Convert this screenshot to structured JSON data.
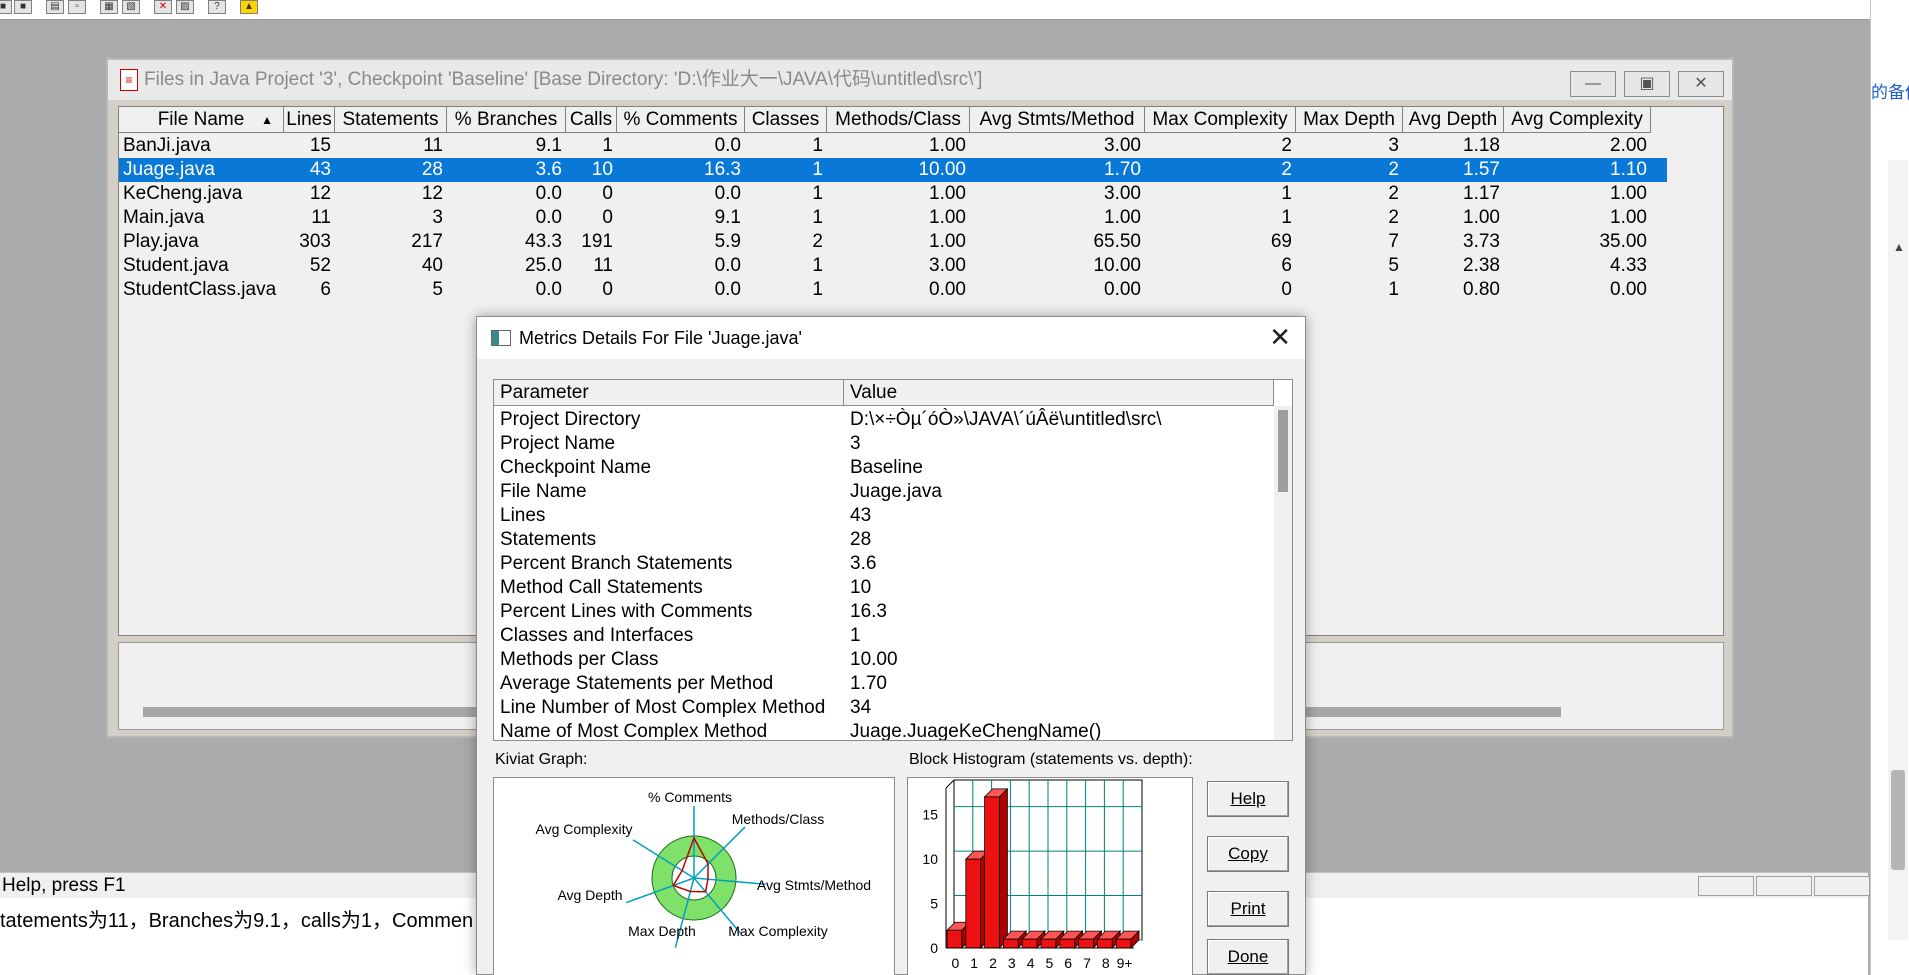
{
  "status_bar": {
    "text": "Help, press F1"
  },
  "below_text": "tatements为11，Branches为9.1，calls为1，Commen",
  "right_partial_text": "的备份",
  "files_window": {
    "title": "Files in Java Project '3', Checkpoint 'Baseline'  [Base Directory: 'D:\\作业大一\\JAVA\\代码\\untitled\\src\\']",
    "columns": [
      "File Name",
      "Lines",
      "Statements",
      "% Branches",
      "Calls",
      "% Comments",
      "Classes",
      "Methods/Class",
      "Avg Stmts/Method",
      "Max Complexity",
      "Max Depth",
      "Avg Depth",
      "Avg Complexity"
    ],
    "rows": [
      [
        "BanJi.java",
        "15",
        "11",
        "9.1",
        "1",
        "0.0",
        "1",
        "1.00",
        "3.00",
        "2",
        "3",
        "1.18",
        "2.00"
      ],
      [
        "Juage.java",
        "43",
        "28",
        "3.6",
        "10",
        "16.3",
        "1",
        "10.00",
        "1.70",
        "2",
        "2",
        "1.57",
        "1.10"
      ],
      [
        "KeCheng.java",
        "12",
        "12",
        "0.0",
        "0",
        "0.0",
        "1",
        "1.00",
        "3.00",
        "1",
        "2",
        "1.17",
        "1.00"
      ],
      [
        "Main.java",
        "11",
        "3",
        "0.0",
        "0",
        "9.1",
        "1",
        "1.00",
        "1.00",
        "1",
        "2",
        "1.00",
        "1.00"
      ],
      [
        "Play.java",
        "303",
        "217",
        "43.3",
        "191",
        "5.9",
        "2",
        "1.00",
        "65.50",
        "69",
        "7",
        "3.73",
        "35.00"
      ],
      [
        "Student.java",
        "52",
        "40",
        "25.0",
        "11",
        "0.0",
        "1",
        "3.00",
        "10.00",
        "6",
        "5",
        "2.38",
        "4.33"
      ],
      [
        "StudentClass.java",
        "6",
        "5",
        "0.0",
        "0",
        "0.0",
        "1",
        "0.00",
        "0.00",
        "0",
        "1",
        "0.80",
        "0.00"
      ]
    ],
    "selected_row": 1
  },
  "dialog": {
    "title": "Metrics Details For File 'Juage.java'",
    "param_header": "Parameter",
    "value_header": "Value",
    "params": [
      [
        "Project Directory",
        "D:\\×÷Òµ´óÒ»\\JAVA\\´úÂë\\untitled\\src\\"
      ],
      [
        "Project Name",
        "3"
      ],
      [
        "Checkpoint Name",
        "Baseline"
      ],
      [
        "File Name",
        "Juage.java"
      ],
      [
        "Lines",
        "43"
      ],
      [
        "Statements",
        "28"
      ],
      [
        "Percent Branch Statements",
        "3.6"
      ],
      [
        "Method Call Statements",
        "10"
      ],
      [
        "Percent Lines with Comments",
        "16.3"
      ],
      [
        "Classes and Interfaces",
        "1"
      ],
      [
        "Methods per Class",
        "10.00"
      ],
      [
        "Average Statements per Method",
        "1.70"
      ],
      [
        "Line Number of Most Complex Method",
        "34"
      ],
      [
        "Name of Most Complex Method",
        "Juage.JuageKeChengName()"
      ]
    ],
    "kiviat_label": "Kiviat Graph:",
    "histogram_label": "Block Histogram (statements vs. depth):",
    "buttons": {
      "help": "Help",
      "copy": "Copy",
      "print": "Print",
      "done": "Done"
    }
  },
  "chart_data": [
    {
      "type": "radar",
      "axes": [
        "% Comments",
        "Methods/Class",
        "Avg Stmts/Method",
        "Max Complexity",
        "Max Depth",
        "Avg Depth",
        "Avg Complexity"
      ]
    },
    {
      "type": "bar",
      "categories": [
        "0",
        "1",
        "2",
        "3",
        "4",
        "5",
        "6",
        "7",
        "8",
        "9+"
      ],
      "values": [
        2,
        10,
        17,
        1,
        1,
        1,
        1,
        1,
        1,
        1
      ],
      "ylim": [
        0,
        18
      ],
      "yticks": [
        "0",
        "5",
        "10",
        "15"
      ]
    }
  ],
  "colors": {
    "selection": "#0a78d7",
    "hist_bar": "#ee1111",
    "kiviat_ring": "#7fe06a"
  }
}
